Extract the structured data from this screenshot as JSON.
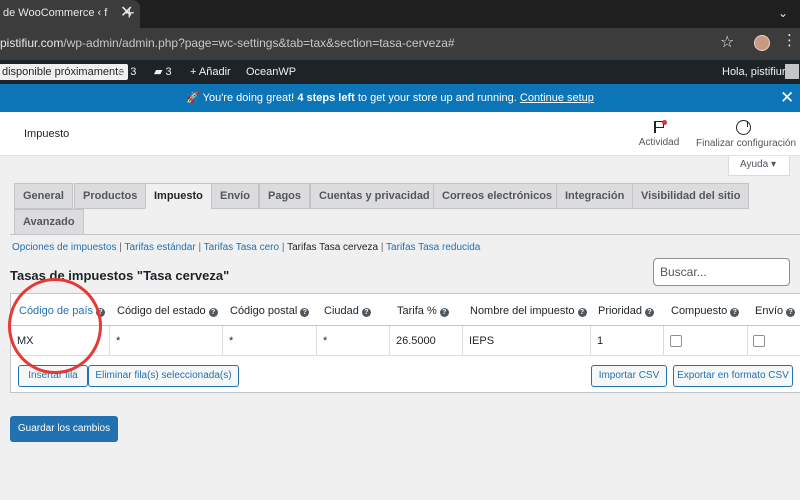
{
  "browser": {
    "tab_title": "de WooCommerce ‹ f",
    "tab_close": "✕",
    "new_tab": "+",
    "tab_ctrl": "⌄",
    "url_host": "pistifiur.com",
    "url_path": "/wp-admin/admin.php?page=wc-settings&tab=tax&section=tasa-cerveza#",
    "star": "☆",
    "menu": "⋮"
  },
  "adminbar": {
    "notice": "disponible próximamente",
    "updates_count": "3",
    "comments_count": "3",
    "add_label": "Añadir",
    "theme_label": "OceanWP",
    "greeting": "Hola, pistifiur"
  },
  "banner": {
    "icon": "🚀",
    "lead": "You're doing great!",
    "bold": "4 steps left",
    "text": "to get your store up and running.",
    "link": "Continue setup",
    "close": "✕"
  },
  "wc_header": {
    "title": "Impuesto",
    "activity_label": "Actividad",
    "finish_label": "Finalizar configuración",
    "help_label": "Ayuda ▾"
  },
  "tabs": [
    {
      "label": "General"
    },
    {
      "label": "Productos"
    },
    {
      "label": "Impuesto"
    },
    {
      "label": "Envío"
    },
    {
      "label": "Pagos"
    },
    {
      "label": "Cuentas y privacidad"
    },
    {
      "label": "Correos electrónicos"
    },
    {
      "label": "Integración"
    },
    {
      "label": "Visibilidad del sitio"
    },
    {
      "label": "Avanzado"
    }
  ],
  "subsections": {
    "options": "Opciones de impuestos",
    "standard": "Tarifas estándar",
    "zero": "Tarifas Tasa cero",
    "beer": "Tarifas Tasa cerveza",
    "reduced": "Tarifas Tasa reducida",
    "sep": "|"
  },
  "section_title": "Tasas de impuestos \"Tasa cerveza\"",
  "search": {
    "placeholder": "Buscar..."
  },
  "table": {
    "headers": {
      "country": "Código de país",
      "state": "Código del estado",
      "postcode": "Código postal",
      "city": "Ciudad",
      "rate": "Tarifa %",
      "name": "Nombre del impuesto",
      "priority": "Prioridad",
      "compound": "Compuesto",
      "shipping": "Envío"
    },
    "help_glyph": "?",
    "row": {
      "country": "MX",
      "state": "*",
      "postcode": "*",
      "city": "*",
      "rate": "26.5000",
      "name": "IEPS",
      "priority": "1",
      "compound": false,
      "shipping": false
    },
    "buttons": {
      "insert": "Insertar fila",
      "remove": "Eliminar fila(s) seleccionada(s)",
      "import": "Importar CSV",
      "export": "Exportar en formato CSV"
    }
  },
  "save_label": "Guardar los cambios",
  "colors": {
    "banner": "#0b75b8",
    "primary": "#2271b1",
    "annotation": "#e53935"
  }
}
